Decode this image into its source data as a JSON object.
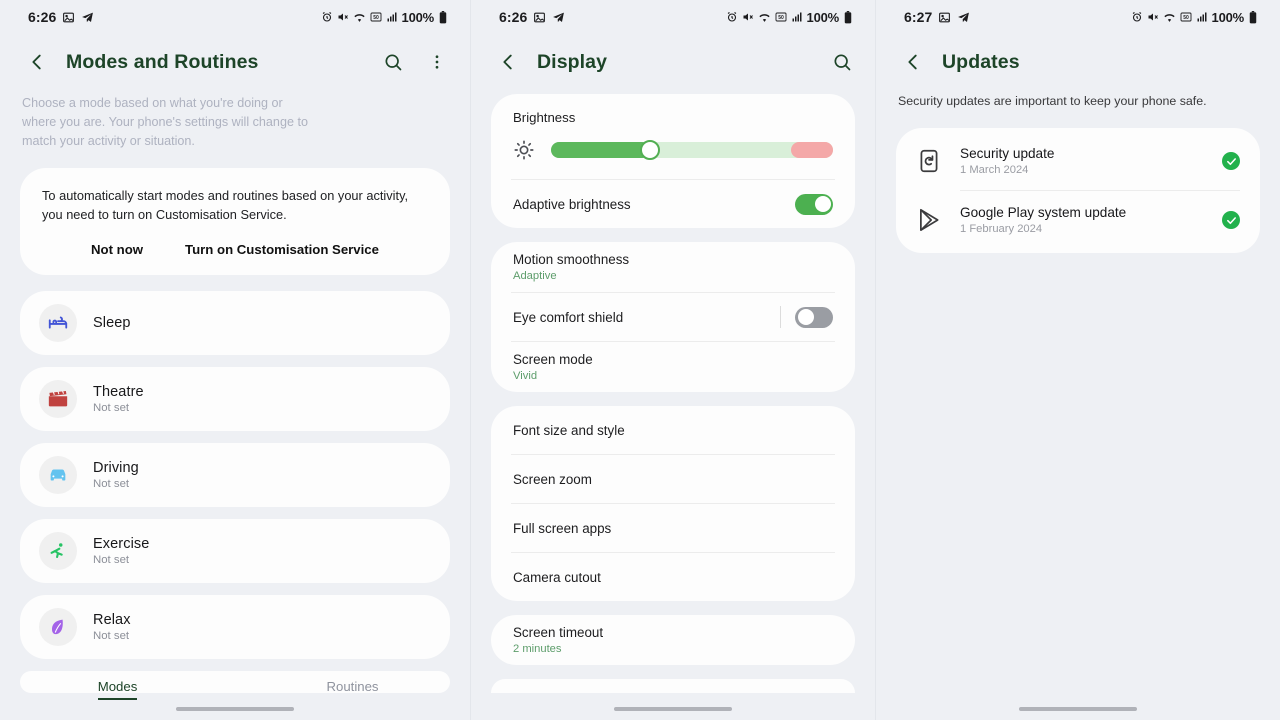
{
  "screens": {
    "modes": {
      "status": {
        "time": "6:26",
        "battery": "100%"
      },
      "appbar": {
        "title": "Modes and Routines",
        "back_icon": "back-chevron-icon",
        "search_icon": "search-icon",
        "more_icon": "more-vertical-icon"
      },
      "intro": "Choose a mode based on what you're doing or where you are. Your phone's settings will change to match your activity or situation.",
      "notice": {
        "text": "To automatically start modes and routines based on your activity, you need to turn on Customisation Service.",
        "secondary_label": "Not now",
        "primary_label": "Turn on Customisation Service"
      },
      "modes": [
        {
          "name": "Sleep",
          "sub": "",
          "icon": "bed-icon",
          "color": "#4355d6"
        },
        {
          "name": "Theatre",
          "sub": "Not set",
          "icon": "clapperboard-icon",
          "color": "#c0423f"
        },
        {
          "name": "Driving",
          "sub": "Not set",
          "icon": "car-icon",
          "color": "#63c3ef"
        },
        {
          "name": "Exercise",
          "sub": "Not set",
          "icon": "running-icon",
          "color": "#27c365"
        },
        {
          "name": "Relax",
          "sub": "Not set",
          "icon": "leaf-icon",
          "color": "#a463e8"
        }
      ],
      "tabs": [
        {
          "label": "Modes",
          "active": true
        },
        {
          "label": "Routines",
          "active": false
        }
      ]
    },
    "display": {
      "status": {
        "time": "6:26",
        "battery": "100%"
      },
      "appbar": {
        "title": "Display",
        "back_icon": "back-chevron-icon",
        "search_icon": "search-icon"
      },
      "brightness": {
        "label": "Brightness",
        "icon": "sun-icon",
        "value_percent": 35,
        "hot_zone_start_percent": 85
      },
      "adaptive_brightness": {
        "label": "Adaptive brightness",
        "state": "on"
      },
      "group2": [
        {
          "label": "Motion smoothness",
          "sub": "Adaptive",
          "control": "none"
        },
        {
          "label": "Eye comfort shield",
          "sub": "",
          "control": "toggle",
          "state": "off"
        },
        {
          "label": "Screen mode",
          "sub": "Vivid",
          "control": "none"
        }
      ],
      "group3": [
        {
          "label": "Font size and style"
        },
        {
          "label": "Screen zoom"
        },
        {
          "label": "Full screen apps"
        },
        {
          "label": "Camera cutout"
        }
      ],
      "group4": [
        {
          "label": "Screen timeout",
          "sub": "2 minutes"
        }
      ]
    },
    "updates": {
      "status": {
        "time": "6:27",
        "battery": "100%"
      },
      "appbar": {
        "title": "Updates",
        "back_icon": "back-chevron-icon"
      },
      "description": "Security updates are important to keep your phone safe.",
      "items": [
        {
          "name": "Security update",
          "date": "1 March 2024",
          "icon": "phone-update-icon",
          "status": "up-to-date"
        },
        {
          "name": "Google Play system update",
          "date": "1 February 2024",
          "icon": "play-store-icon",
          "status": "up-to-date"
        }
      ]
    }
  },
  "colors": {
    "background": "#eef0f4",
    "card": "#fdfdfd",
    "accent_green": "#1d4428",
    "toggle_on": "#4cb050",
    "check_green": "#22b14c",
    "slider_fill": "#5cb85c",
    "slider_track": "#d9efd9",
    "slider_hot": "#f4a8a8"
  }
}
